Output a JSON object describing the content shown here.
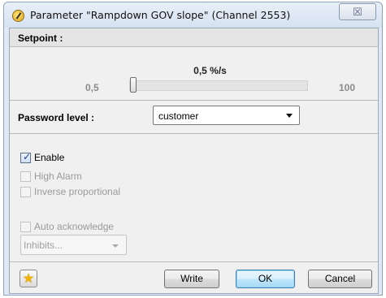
{
  "window": {
    "title": "Parameter \"Rampdown GOV slope\" (Channel 2553)",
    "close_symbol": "☒"
  },
  "setpoint": {
    "label": "Setpoint :",
    "value": "0,5 %/s",
    "min": "0,5",
    "max": "100",
    "level": 0.0
  },
  "password": {
    "label": "Password level :",
    "selected": "customer"
  },
  "checkboxes": {
    "enable": {
      "label": "Enable",
      "checked": true,
      "enabled": true
    },
    "high_alarm": {
      "label": "High Alarm",
      "checked": false,
      "enabled": false
    },
    "inverse_proportional": {
      "label": "Inverse proportional",
      "checked": false,
      "enabled": false
    },
    "auto_acknowledge": {
      "label": "Auto acknowledge",
      "checked": false,
      "enabled": false
    }
  },
  "inhibits": {
    "placeholder": "Inhibits..."
  },
  "buttons": {
    "write": "Write",
    "ok": "OK",
    "cancel": "Cancel"
  },
  "icons": {
    "title": "gauge-icon",
    "favorite": "star-icon"
  }
}
